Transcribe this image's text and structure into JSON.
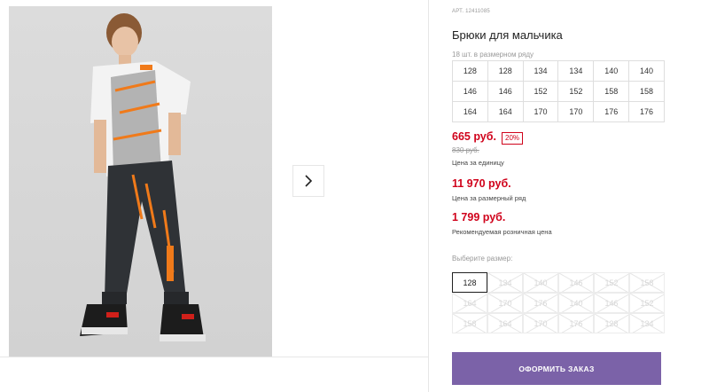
{
  "product": {
    "article": "АРТ. 12411085",
    "title": "Брюки для мальчика",
    "pack_note": "18 шт. в размерном ряду"
  },
  "size_table": {
    "rows": [
      [
        "128",
        "128",
        "134",
        "134",
        "140",
        "140"
      ],
      [
        "146",
        "146",
        "152",
        "152",
        "158",
        "158"
      ],
      [
        "164",
        "164",
        "170",
        "170",
        "176",
        "176"
      ]
    ]
  },
  "pricing": {
    "unit_price": "665 руб.",
    "discount": "20%",
    "old_price": "830 руб.",
    "unit_caption": "Цена за единицу",
    "pack_price": "11 970 руб.",
    "pack_caption": "Цена за размерный ряд",
    "retail_price": "1 799 руб.",
    "retail_caption": "Рекомендуемая розничная цена"
  },
  "size_choice": {
    "label": "Выберите размер:",
    "selected": "128",
    "options": [
      "128",
      "134",
      "140",
      "146",
      "152",
      "158",
      "164",
      "170",
      "176",
      "140",
      "146",
      "152",
      "158",
      "164",
      "170",
      "176",
      "128",
      "134"
    ]
  },
  "actions": {
    "order_label": "ОФОРМИТЬ ЗАКАЗ"
  },
  "colors": {
    "accent": "#7b62a8",
    "price": "#d0021b"
  },
  "icons": {
    "next": "chevron-right-icon"
  }
}
